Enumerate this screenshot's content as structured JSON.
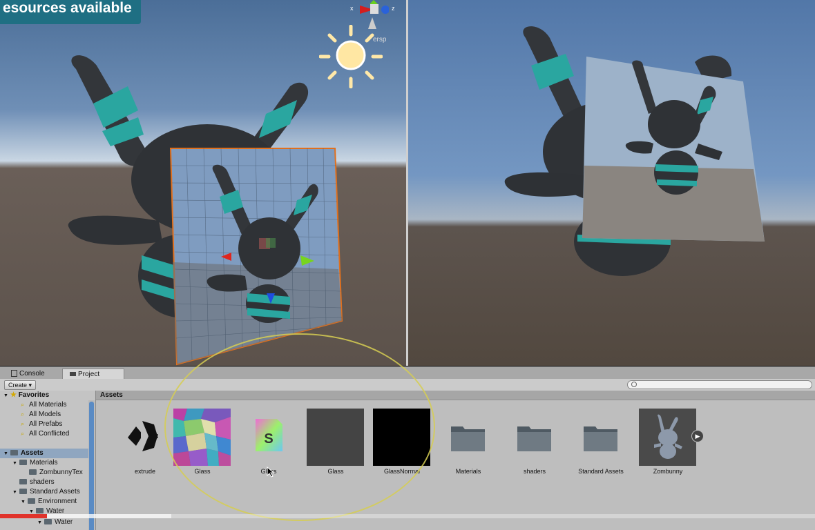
{
  "banner": {
    "text": "esources available"
  },
  "scene_view": {
    "projection_label": "ersp",
    "gizmo_axes": {
      "x": "x",
      "z": "z"
    },
    "icons": [
      "sun-icon",
      "orientation-gizmo"
    ]
  },
  "bottom_panel": {
    "tabs": [
      {
        "label": "Console",
        "icon": "console-icon",
        "active": false
      },
      {
        "label": "Project",
        "icon": "project-icon",
        "active": true
      }
    ],
    "toolbar": {
      "create_label": "Create ▾",
      "search_placeholder": ""
    },
    "sidebar": {
      "favorites": {
        "label": "Favorites",
        "items": [
          "All Materials",
          "All Models",
          "All Prefabs",
          "All Conflicted"
        ]
      },
      "assets": {
        "label": "Assets",
        "items": [
          {
            "label": "Materials",
            "depth": 1,
            "expanded": true
          },
          {
            "label": "ZombunnyTex",
            "depth": 2
          },
          {
            "label": "shaders",
            "depth": 1
          },
          {
            "label": "Standard Assets",
            "depth": 1,
            "expanded": true
          },
          {
            "label": "Environment",
            "depth": 2,
            "expanded": true
          },
          {
            "label": "Water",
            "depth": 3,
            "expanded": true
          },
          {
            "label": "Water",
            "depth": 4,
            "expanded": true
          }
        ]
      }
    },
    "breadcrumb": "Assets",
    "assets": [
      {
        "label": "extrude",
        "kind": "unity-logo"
      },
      {
        "label": "Glass",
        "kind": "glass-texture"
      },
      {
        "label": "Glass",
        "kind": "shader"
      },
      {
        "label": "Glass",
        "kind": "material-gray"
      },
      {
        "label": "GlassNormal",
        "kind": "material-black"
      },
      {
        "label": "Materials",
        "kind": "folder"
      },
      {
        "label": "shaders",
        "kind": "folder"
      },
      {
        "label": "Standard Assets",
        "kind": "folder"
      },
      {
        "label": "Zombunny",
        "kind": "model"
      }
    ]
  },
  "video": {
    "progress_fraction": 0.058,
    "buffered_fraction": 0.21
  },
  "colors": {
    "highlight_ring": "#d6ce52",
    "progress_played": "#e0332b",
    "banner_bg": "#1f6f83",
    "selection_outline": "#e0701e"
  }
}
